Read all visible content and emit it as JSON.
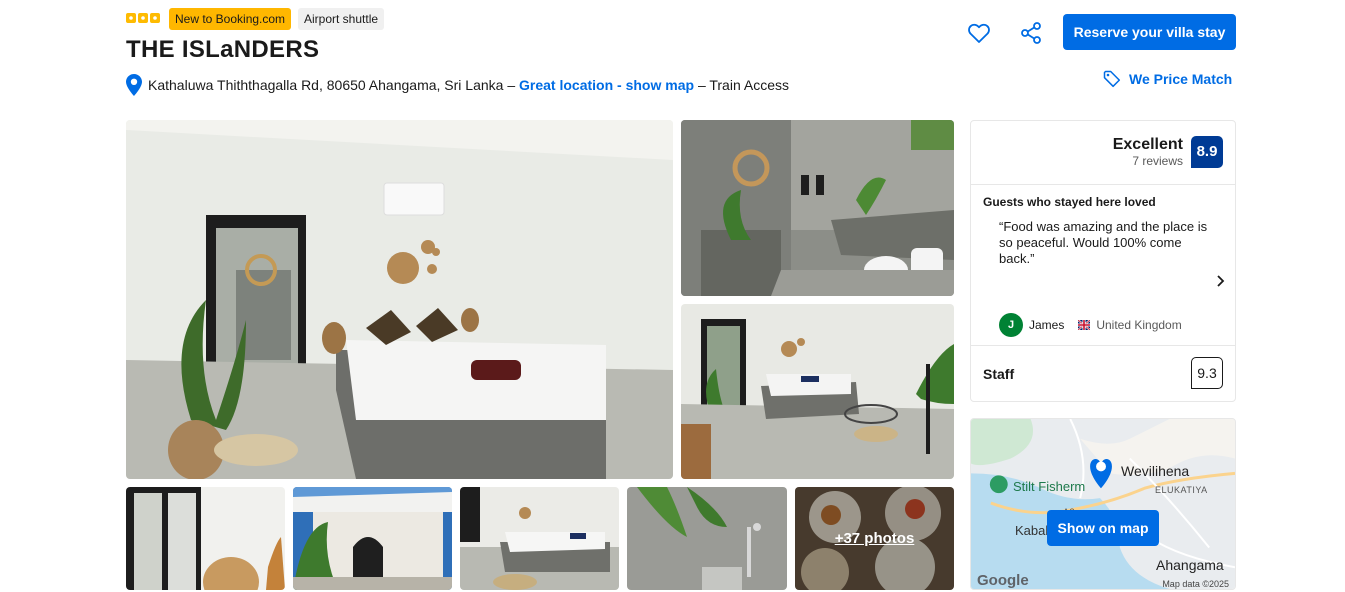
{
  "header": {
    "star_rating": 3,
    "badges": [
      "New to Booking.com",
      "Airport shuttle"
    ],
    "title": "THE ISLaNDERS",
    "address": "Kathaluwa Thiththagalla Rd, 80650 Ahangama, Sri Lanka –",
    "location_link": "Great location - show map",
    "extra": "– Train Access",
    "reserve_label": "Reserve your villa stay",
    "price_match_label": "We Price Match"
  },
  "gallery": {
    "more_photos_label": "+37 photos"
  },
  "review": {
    "score_word": "Excellent",
    "review_count": "7 reviews",
    "score": "8.9",
    "loved_heading": "Guests who stayed here loved",
    "quote": "“Food was amazing and the place is so peaceful. Would 100% come back.”",
    "reviewer_initial": "J",
    "reviewer_name": "James",
    "reviewer_country": "United Kingdom",
    "staff_label": "Staff",
    "staff_score": "9.3"
  },
  "map": {
    "show_label": "Show on map",
    "labels": {
      "wevilihena": "Wevilihena",
      "elukatiya": "ELUKATIYA",
      "stilt": "Stilt Fisherm",
      "kabala": "Kabala",
      "ahangama": "Ahangama",
      "road": "A2",
      "google": "Google",
      "map_data": "Map data ©2025"
    }
  },
  "colors": {
    "brand_blue": "#006ce4",
    "score_blue": "#003b95",
    "badge_yellow": "#ffb700"
  }
}
